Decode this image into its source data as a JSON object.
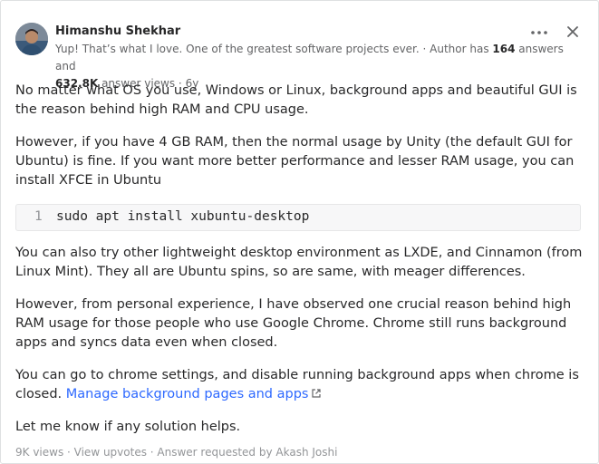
{
  "author": {
    "name": "Himanshu Shekhar",
    "credential_text": "Yup! That’s what I love. One of the greatest software projects ever. · Author has ",
    "answers_count": "164",
    "answers_label": " answers and",
    "views_count": "632.8K",
    "views_label": " answer views · 6y"
  },
  "icons": {
    "more": "more-options-icon",
    "close": "close-icon",
    "external": "external-link-icon"
  },
  "answer": {
    "p1": "No matter what OS you use, Windows or Linux, background apps and beautiful GUI is the reason behind high RAM and CPU usage.",
    "p2": "However, if you have 4 GB RAM, then the normal usage by Unity (the default GUI for Ubuntu) is fine. If you want more better performance and lesser RAM usage, you can install XFCE in Ubuntu",
    "code_line_number": "1",
    "code": "sudo apt install xubuntu-desktop",
    "p3": "You can also try other lightweight desktop environment as LXDE, and Cinnamon (from Linux Mint). They all are Ubuntu spins, so are same, with meager differences.",
    "p4": "However, from personal experience, I have observed one crucial reason behind high RAM usage for those people who use Google Chrome. Chrome still runs background apps and syncs data even when closed.",
    "p5_text": "You can go to chrome settings, and disable running background apps when chrome is closed. ",
    "p5_link": "Manage background pages and apps",
    "p6": "Let me know if any solution helps."
  },
  "footer": {
    "views": "9K views",
    "sep1": " · ",
    "upvotes": "View upvotes",
    "sep2": " · ",
    "requested": "Answer requested by ",
    "requester": "Akash Joshi"
  },
  "colors": {
    "link": "#2e69ff",
    "text": "#282829",
    "muted": "#636466"
  }
}
